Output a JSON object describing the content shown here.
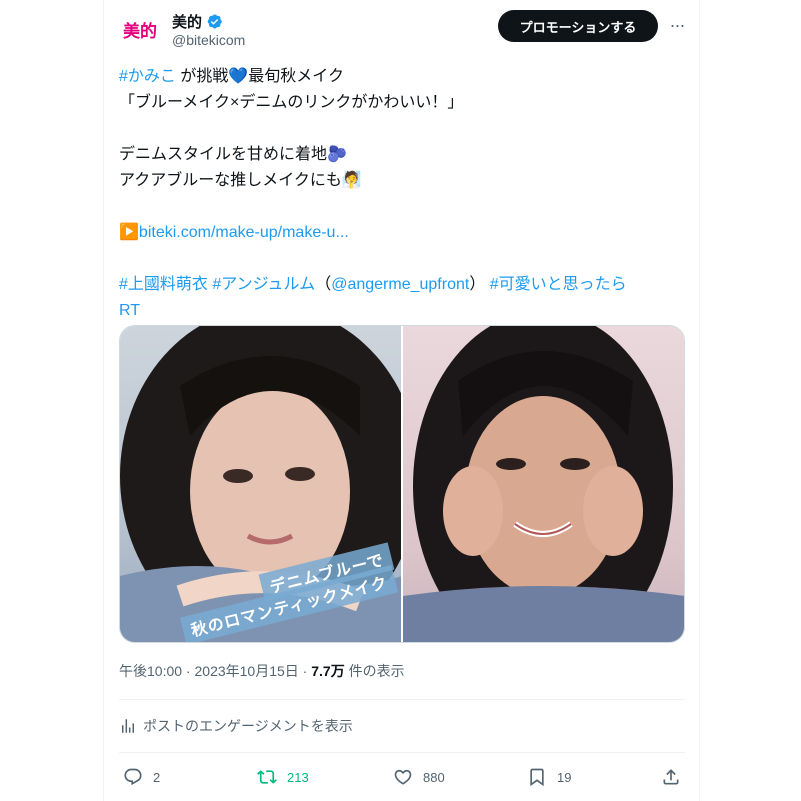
{
  "account": {
    "avatar_text": "美的",
    "name": "美的",
    "handle": "@bitekicom"
  },
  "header": {
    "promote_label": "プロモーションする",
    "more_label": "···"
  },
  "tweet": {
    "line1_tag": "#かみこ",
    "line1_text": " が挑戦",
    "line1_heart": "💙",
    "line1_tail": "最旬秋メイク",
    "line2": "「ブルーメイク×デニムのリンクがかわいい！」",
    "line3": "デニムスタイルを甘めに着地🫐",
    "line4": "アクアブルーな推しメイクにも🧖",
    "link_icon": "▶️",
    "link": "biteki.com/make-up/make-u...",
    "tags_1": "#上國料萌衣",
    "tags_2": "#アンジュルム",
    "tags_3_open": "（",
    "tags_3_mention": "@angerme_upfront",
    "tags_3_close": "）",
    "tags_4": "#可愛いと思ったら",
    "tags_5": "RT"
  },
  "media": {
    "caption_1": "デニムブルーで",
    "caption_2": "秋のロマンティックメイク"
  },
  "meta": {
    "time": "午後10:00",
    "sep": " · ",
    "date": "2023年10月15日",
    "views_count": "7.7万",
    "views_label": " 件の表示"
  },
  "engagement_label": "ポストのエンゲージメントを表示",
  "actions": {
    "replies": "2",
    "retweets": "213",
    "likes": "880",
    "bookmarks": "19"
  },
  "colors": {
    "link": "#1d9bf0",
    "brand": "#e3007f",
    "retweet": "#00ba7c",
    "secondary": "#536471"
  }
}
